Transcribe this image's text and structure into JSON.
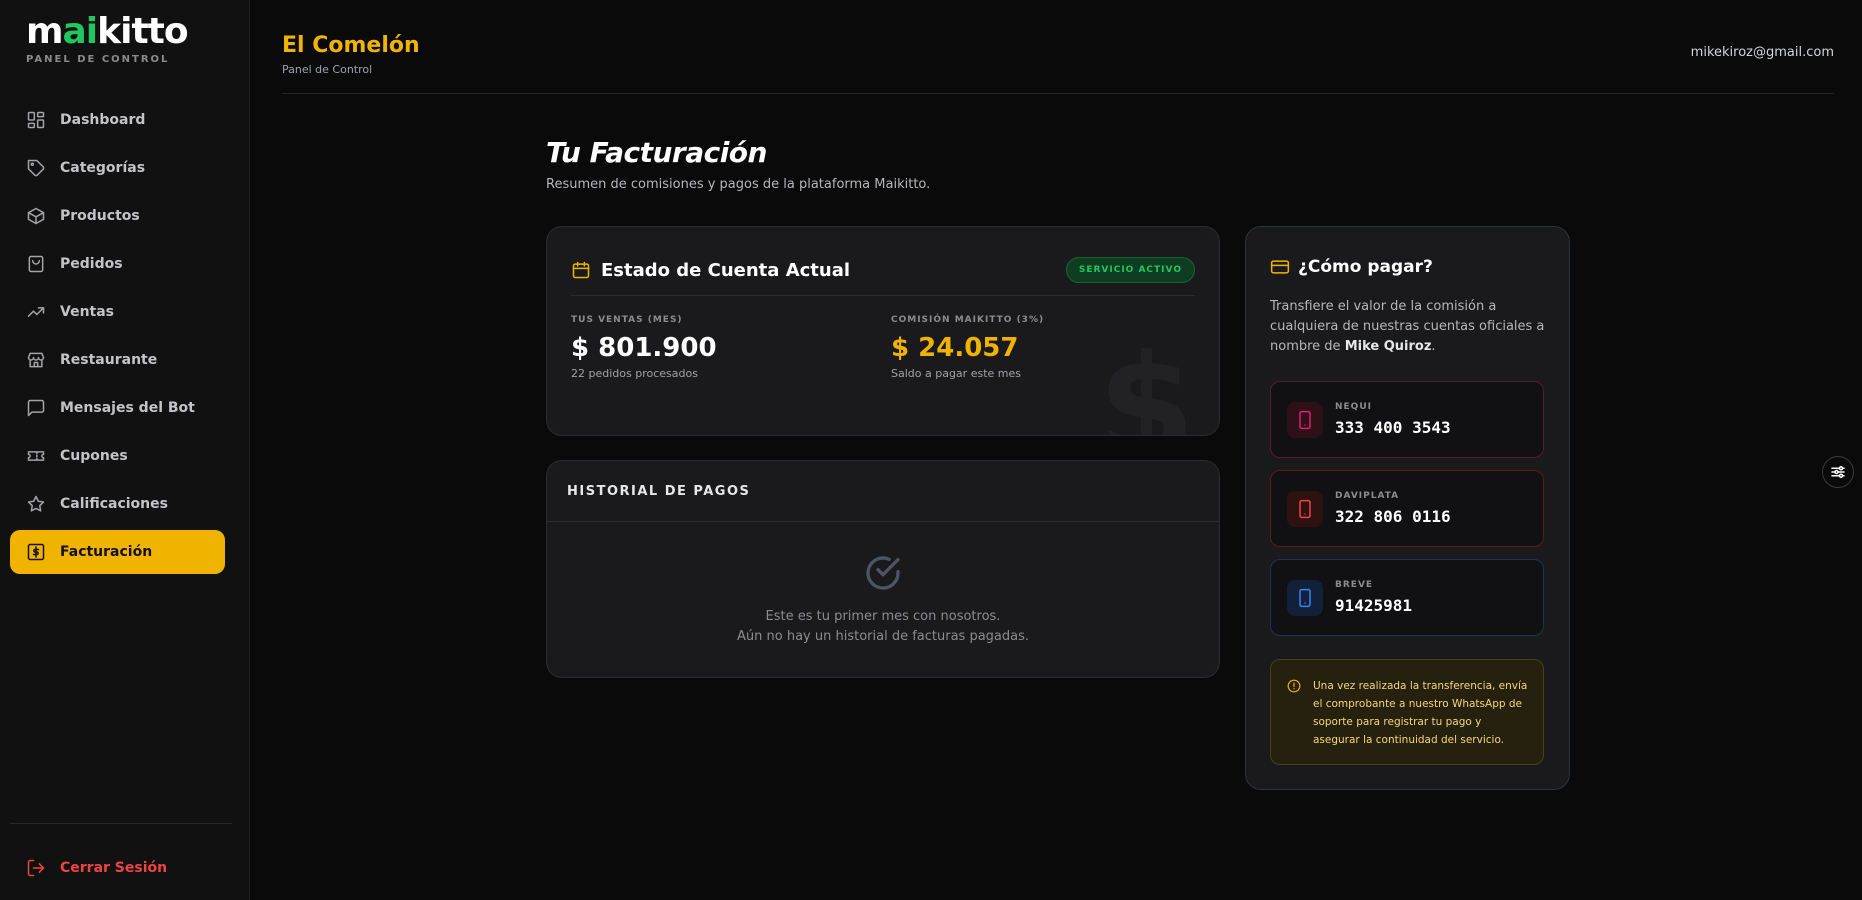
{
  "sidebar": {
    "logo_pre": "m",
    "logo_accent": "ai",
    "logo_post": "kitto",
    "logo_sub": "PANEL DE CONTROL",
    "items": [
      {
        "label": "Dashboard",
        "icon": "dashboard-icon"
      },
      {
        "label": "Categorías",
        "icon": "tag-icon"
      },
      {
        "label": "Productos",
        "icon": "box-icon"
      },
      {
        "label": "Pedidos",
        "icon": "shopping-bag-icon"
      },
      {
        "label": "Ventas",
        "icon": "trending-up-icon"
      },
      {
        "label": "Restaurante",
        "icon": "store-icon"
      },
      {
        "label": "Mensajes del Bot",
        "icon": "message-icon"
      },
      {
        "label": "Cupones",
        "icon": "ticket-icon"
      },
      {
        "label": "Calificaciones",
        "icon": "star-icon"
      },
      {
        "label": "Facturación",
        "icon": "dollar-icon"
      }
    ],
    "active_index": 9,
    "logout_label": "Cerrar Sesión"
  },
  "header": {
    "brand": "El Comelón",
    "brand_sub": "Panel de Control",
    "user_email": "mikekiroz@gmail.com"
  },
  "main": {
    "title": "Tu Facturación",
    "subtitle": "Resumen de comisiones y pagos de la plataforma Maikitto."
  },
  "estado": {
    "title": "Estado de Cuenta Actual",
    "badge": "SERVICIO ACTIVO",
    "ventas_label": "TUS VENTAS (MES)",
    "ventas_value": "$ 801.900",
    "ventas_note": "22 pedidos procesados",
    "comision_label": "COMISIÓN MAIKITTO (3%)",
    "comision_value": "$ 24.057",
    "comision_note": "Saldo a pagar este mes",
    "watermark": "$"
  },
  "historial": {
    "title": "HISTORIAL DE PAGOS",
    "empty_line1": "Este es tu primer mes con nosotros.",
    "empty_line2": "Aún no hay un historial de facturas pagadas."
  },
  "pagar": {
    "title": "¿Cómo pagar?",
    "desc_pre": "Transfiere el valor de la comisión a cualquiera de nuestras cuentas oficiales a nombre de ",
    "desc_name": "Mike Quiroz",
    "desc_post": ".",
    "accounts": [
      {
        "label": "NEQUI",
        "number": "333 400 3543",
        "color": "#e11d74"
      },
      {
        "label": "DAVIPLATA",
        "number": "322 806 0116",
        "color": "#ef4444"
      },
      {
        "label": "BREVE",
        "number": "91425981",
        "color": "#3b82f6"
      }
    ],
    "notice": "Una vez realizada la transferencia, envía el comprobante a nuestro WhatsApp de soporte para registrar tu pago y asegurar la continuidad del servicio."
  },
  "colors": {
    "accent": "#f0b400",
    "active_green": "#22c55e",
    "danger": "#ef4444"
  }
}
